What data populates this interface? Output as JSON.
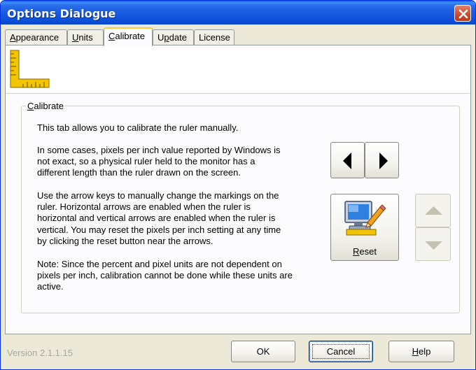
{
  "window": {
    "title": "Options Dialogue"
  },
  "tabs": [
    {
      "label": "Appearance",
      "accel": "A",
      "rest": "ppearance"
    },
    {
      "label": "Units",
      "accel": "U",
      "rest": "nits"
    },
    {
      "label": "Calibrate",
      "accel": "C",
      "rest": "alibrate",
      "active": true
    },
    {
      "label": "Update",
      "accel": "p",
      "pre": "U",
      "rest": "date"
    },
    {
      "label": "License"
    }
  ],
  "group": {
    "legend": "Calibrate",
    "legend_accel": "C",
    "legend_rest": "alibrate"
  },
  "paragraphs": {
    "intro": [
      "This tab allows you to calibrate the ruler manually."
    ],
    "p2": [
      "In some cases, pixels per inch value reported by Windows is",
      "not exact, so a physical ruler held to the monitor has a",
      "different length than the ruler drawn on the screen."
    ],
    "p3": [
      "Use the arrow keys to manually change the markings on the",
      "ruler.  Horizontal arrows are enabled when the ruler is",
      "horizontal and vertical arrows are enabled when the ruler is",
      "vertical.  You may reset the pixels per inch setting at any time",
      "by clicking the reset button near the arrows."
    ],
    "p4": [
      "Note: Since the percent and pixel units are not dependent on",
      "pixels per inch, calibration cannot be done while these units are",
      "active."
    ]
  },
  "controls": {
    "reset_label": "Reset",
    "reset_accel": "R",
    "reset_rest": "eset"
  },
  "footer": {
    "version": "Version 2.1.1.15",
    "ok": "OK",
    "cancel": "Cancel",
    "help": "Help",
    "help_accel": "H",
    "help_rest": "elp"
  },
  "colors": {
    "titlebar": "#0A5FE8",
    "close": "#C94A2A",
    "face": "#ECE9D8",
    "active_tab_highlight": "#FFC83C",
    "ruler": "#F2C500"
  },
  "icons": [
    "close-icon",
    "ruler-icon",
    "arrow-left-icon",
    "arrow-right-icon",
    "monitor-pencil-icon",
    "arrow-up-icon",
    "arrow-down-icon"
  ]
}
